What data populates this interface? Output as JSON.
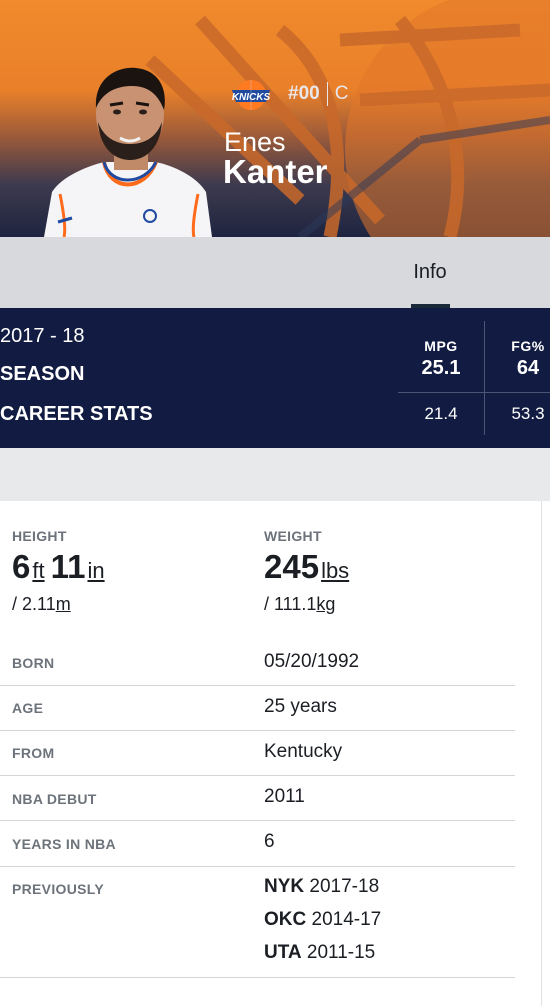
{
  "player": {
    "first_name": "Enes",
    "last_name": "Kanter",
    "number": "#00",
    "position": "C",
    "team_logo": "knicks-logo"
  },
  "tabs": [
    {
      "label": "Info",
      "active": true
    }
  ],
  "stats": {
    "season_years": "2017 - 18",
    "season_label": "SEASON",
    "career_label": "CAREER STATS",
    "columns": [
      {
        "header": "MPG",
        "season": "25.1",
        "career": "21.4"
      },
      {
        "header": "FG%",
        "season": "64",
        "career": "53.3"
      }
    ]
  },
  "info": {
    "height_label": "HEIGHT",
    "height_ft": "6",
    "height_ft_unit": "ft",
    "height_in": "11",
    "height_in_unit": "in",
    "height_metric_prefix": "/ 2.11",
    "height_metric_unit": "m",
    "weight_label": "WEIGHT",
    "weight_value": "245",
    "weight_unit": "lbs",
    "weight_metric_prefix": "/ 111.1",
    "weight_metric_unit": "kg",
    "rows": [
      {
        "label": "BORN",
        "value": "05/20/1992"
      },
      {
        "label": "AGE",
        "value": "25 years"
      },
      {
        "label": "FROM",
        "value": "Kentucky"
      },
      {
        "label": "NBA DEBUT",
        "value": "2011"
      },
      {
        "label": "YEARS IN NBA",
        "value": "6"
      }
    ],
    "previously_label": "PREVIOUSLY",
    "previously": [
      {
        "team": "NYK",
        "years": "2017-18"
      },
      {
        "team": "OKC",
        "years": "2014-17"
      },
      {
        "team": "UTA",
        "years": "2011-15"
      }
    ]
  },
  "colors": {
    "hero_orange": "#f08a2c",
    "navy": "#121c42",
    "tab_gray": "#d7d9dc",
    "label_gray": "#6d737b"
  }
}
